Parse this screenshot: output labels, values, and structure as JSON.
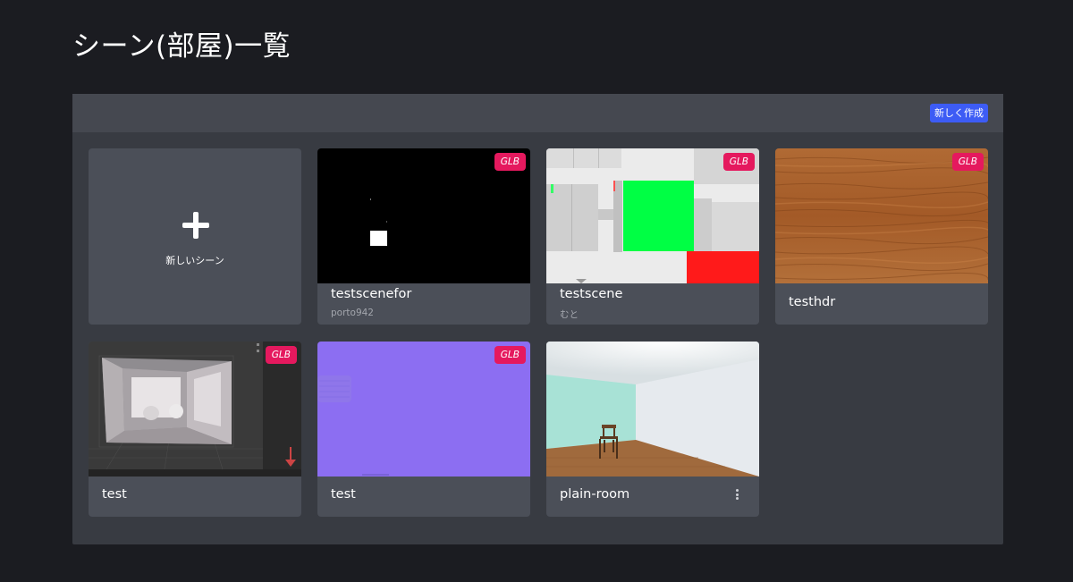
{
  "page": {
    "title": "シーン(部屋)一覧"
  },
  "toolbar": {
    "create_label": "新しく作成"
  },
  "new_scene_card": {
    "label": "新しいシーン",
    "icon": "plus-icon"
  },
  "scenes": [
    {
      "title": "testscenefor",
      "owner": "porto942",
      "badge": "GLB",
      "thumbnail": "black-scene"
    },
    {
      "title": "testscene",
      "owner": "むと",
      "badge": "GLB",
      "thumbnail": "green-wall-scene"
    },
    {
      "title": "testhdr",
      "owner": "",
      "badge": "GLB",
      "thumbnail": "wood-texture"
    },
    {
      "title": "test",
      "owner": "",
      "badge": "GLB",
      "thumbnail": "editor-room-render"
    },
    {
      "title": "test",
      "owner": "",
      "badge": "GLB",
      "thumbnail": "purple-texture"
    },
    {
      "title": "plain-room",
      "owner": "",
      "badge": "",
      "thumbnail": "plain-room-chair",
      "menu_icon": "more-vertical-icon"
    }
  ],
  "colors": {
    "background": "#1b1c21",
    "panel": "#383b42",
    "panel_header": "#454850",
    "card": "#4b4f58",
    "accent_button": "#3d5cf5",
    "badge": "#e5195e"
  }
}
